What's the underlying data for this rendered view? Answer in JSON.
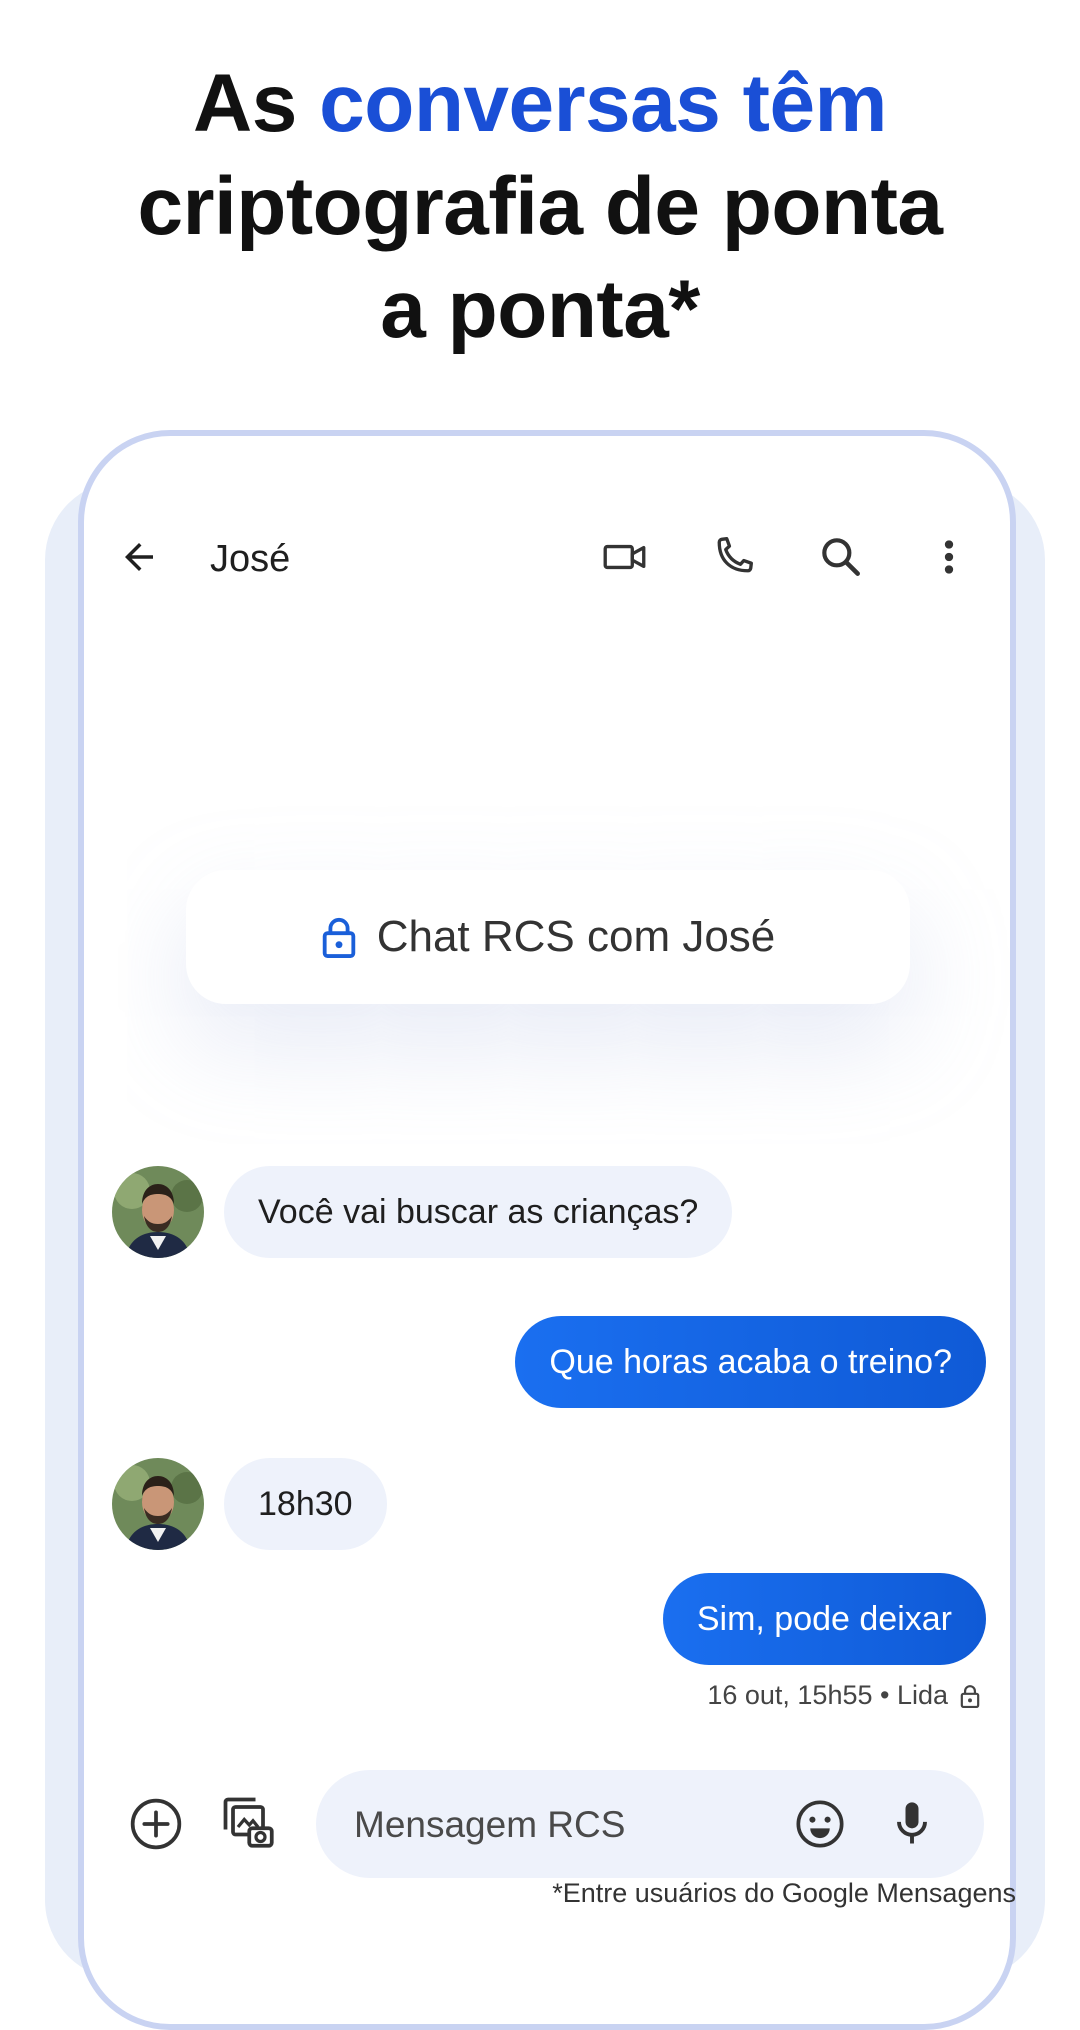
{
  "headline": {
    "part1": "As ",
    "accent": "conversas têm",
    "line2": "criptografia de ponta",
    "line3": "a ponta*"
  },
  "app_bar": {
    "contact_name": "José",
    "icons": [
      "back-arrow-icon",
      "video-call-icon",
      "phone-icon",
      "search-icon",
      "more-vert-icon"
    ]
  },
  "rcs_banner": {
    "text": "Chat RCS com José",
    "icon": "lock-icon"
  },
  "messages": [
    {
      "direction": "incoming",
      "text": "Você vai buscar as crianças?"
    },
    {
      "direction": "outgoing",
      "text": "Que horas acaba o treino?"
    },
    {
      "direction": "incoming",
      "text": "18h30"
    },
    {
      "direction": "outgoing",
      "text": "Sim, pode deixar"
    }
  ],
  "status": {
    "text": "16 out, 15h55 • Lida",
    "icon": "lock-icon"
  },
  "composer": {
    "placeholder": "Mensagem RCS",
    "icons": [
      "add-circle-icon",
      "gallery-icon",
      "emoji-icon",
      "mic-icon"
    ]
  },
  "footnote": "*Entre usuários do Google Mensagens",
  "colors": {
    "accent": "#1a4fd6",
    "outgoing_bubble": "#1a6ff0",
    "incoming_bubble": "#eef2fb",
    "phone_frame": "#c9d3f2"
  }
}
